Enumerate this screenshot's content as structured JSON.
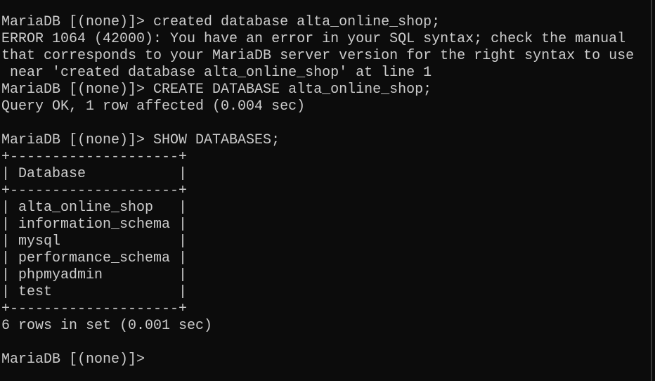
{
  "terminal": {
    "lines": [
      "MariaDB [(none)]> created database alta_online_shop;",
      "ERROR 1064 (42000): You have an error in your SQL syntax; check the manual",
      "that corresponds to your MariaDB server version for the right syntax to use",
      " near 'created database alta_online_shop' at line 1",
      "MariaDB [(none)]> CREATE DATABASE alta_online_shop;",
      "Query OK, 1 row affected (0.004 sec)",
      "",
      "MariaDB [(none)]> SHOW DATABASES;",
      "+--------------------+",
      "| Database           |",
      "+--------------------+",
      "| alta_online_shop   |",
      "| information_schema |",
      "| mysql              |",
      "| performance_schema |",
      "| phpmyadmin         |",
      "| test               |",
      "+--------------------+",
      "6 rows in set (0.001 sec)",
      "",
      "MariaDB [(none)]>"
    ]
  },
  "colors": {
    "background": "#0c0c0c",
    "text": "#cccccc"
  }
}
